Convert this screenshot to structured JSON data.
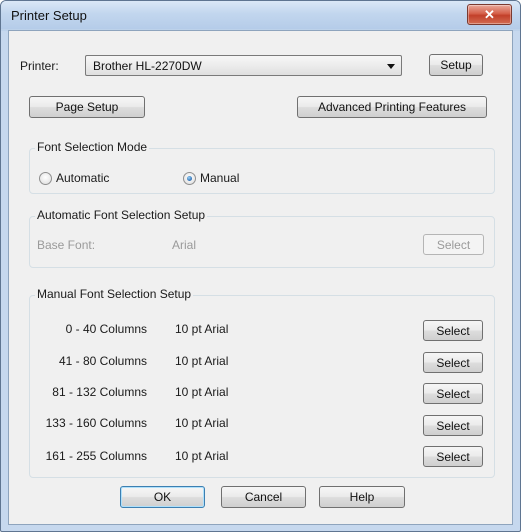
{
  "window": {
    "title": "Printer Setup",
    "close_glyph": "✕"
  },
  "printer": {
    "label": "Printer:",
    "selected": "Brother HL-2270DW",
    "setup_button": "Setup"
  },
  "buttons": {
    "page_setup": "Page Setup",
    "advanced": "Advanced Printing Features",
    "ok": "OK",
    "cancel": "Cancel",
    "help": "Help"
  },
  "font_mode": {
    "title": "Font Selection Mode",
    "automatic": "Automatic",
    "manual": "Manual",
    "selected": "Manual"
  },
  "auto_setup": {
    "title": "Automatic Font Selection Setup",
    "base_font_label": "Base Font:",
    "base_font_value": "Arial",
    "select_button": "Select"
  },
  "manual_setup": {
    "title": "Manual Font Selection Setup",
    "select_label": "Select",
    "rows": [
      {
        "range": "0 - 40 Columns",
        "font": "10 pt Arial"
      },
      {
        "range": "41 - 80 Columns",
        "font": "10 pt Arial"
      },
      {
        "range": "81 - 132 Columns",
        "font": "10 pt Arial"
      },
      {
        "range": "133 - 160 Columns",
        "font": "10 pt Arial"
      },
      {
        "range": "161 - 255 Columns",
        "font": "10 pt Arial"
      }
    ]
  }
}
